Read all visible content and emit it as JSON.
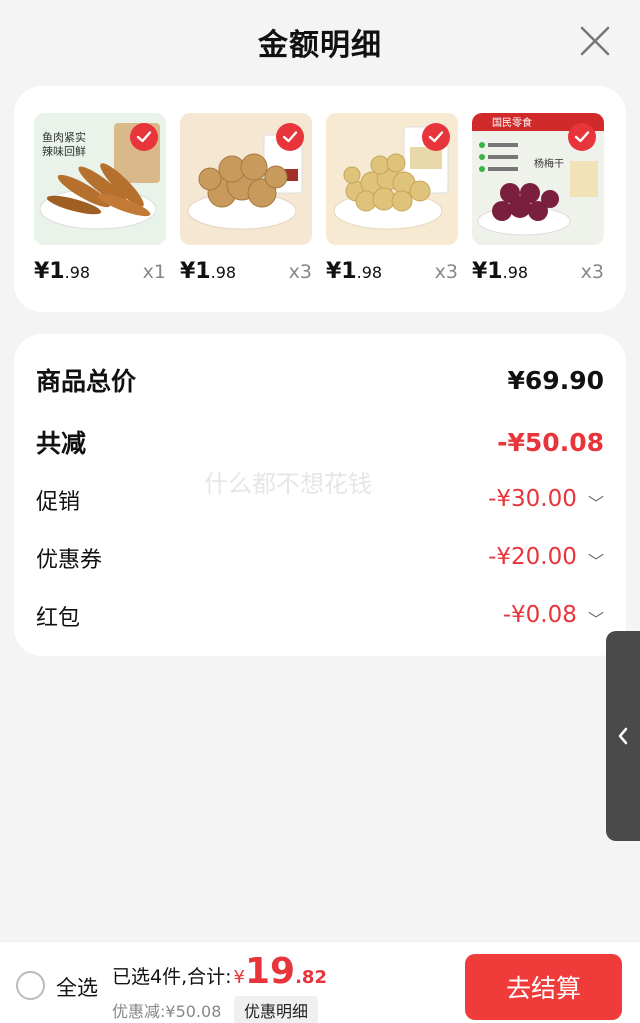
{
  "header": {
    "title": "金额明细"
  },
  "products": [
    {
      "price_main": "¥1",
      "price_dec": ".98",
      "qty": "x1",
      "image": "dried-fish-image",
      "pack_text": "鱼肉紧实 辣味回鲜"
    },
    {
      "price_main": "¥1",
      "price_dec": ".98",
      "qty": "x3",
      "image": "walnut-image"
    },
    {
      "price_main": "¥1",
      "price_dec": ".98",
      "qty": "x3",
      "image": "popcorn-snack-image"
    },
    {
      "price_main": "¥1",
      "price_dec": ".98",
      "qty": "x3",
      "image": "bayberry-image",
      "pack_text": "国民零食",
      "label": "杨梅干"
    }
  ],
  "summary": {
    "total_label": "商品总价",
    "total_value": "¥69.90",
    "reduce_label": "共减",
    "reduce_value": "-¥50.08",
    "promo_label": "促销",
    "promo_value": "-¥30.00",
    "coupon_label": "优惠券",
    "coupon_value": "-¥20.00",
    "redpack_label": "红包",
    "redpack_value": "-¥0.08",
    "watermark": "什么都不想花钱"
  },
  "bottom": {
    "select_all": "全选",
    "selected_text": "已选4件,合计:",
    "currency": "¥",
    "amount_int": "19",
    "amount_dec": ".82",
    "discount_text": "优惠减:¥50.08",
    "detail_button": "优惠明细",
    "checkout_button": "去结算"
  },
  "colors": {
    "accent": "#e8343b",
    "checkout": "#f03b3b"
  }
}
